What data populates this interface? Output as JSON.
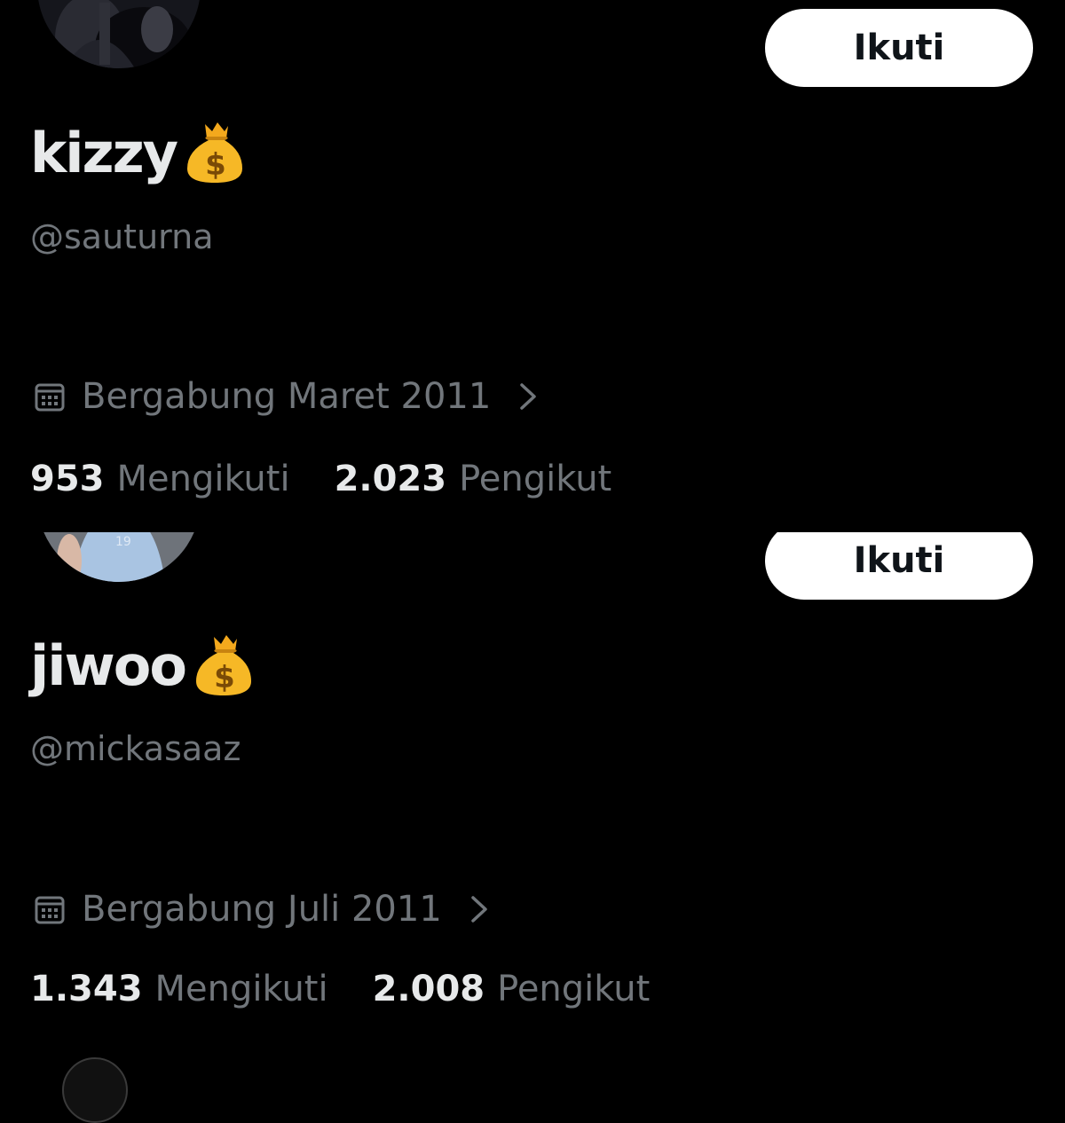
{
  "profiles": [
    {
      "display_name": "kizzy",
      "name_emoji": "money-bag",
      "handle": "@sauturna",
      "follow_label": "Ikuti",
      "joined": "Bergabung Maret 2011",
      "following_count": "953",
      "following_label": "Mengikuti",
      "followers_count": "2.023",
      "followers_label": "Pengikut"
    },
    {
      "display_name": "jiwoo",
      "name_emoji": "money-bag",
      "handle": "@mickasaaz",
      "follow_label": "Ikuti",
      "joined": "Bergabung Juli 2011",
      "following_count": "1.343",
      "following_label": "Mengikuti",
      "followers_count": "2.008",
      "followers_label": "Pengikut"
    }
  ],
  "colors": {
    "background": "#000000",
    "primary_text": "#e7e9ea",
    "secondary_text": "#71767b",
    "button_bg": "#ffffff",
    "button_text": "#0f1419"
  }
}
